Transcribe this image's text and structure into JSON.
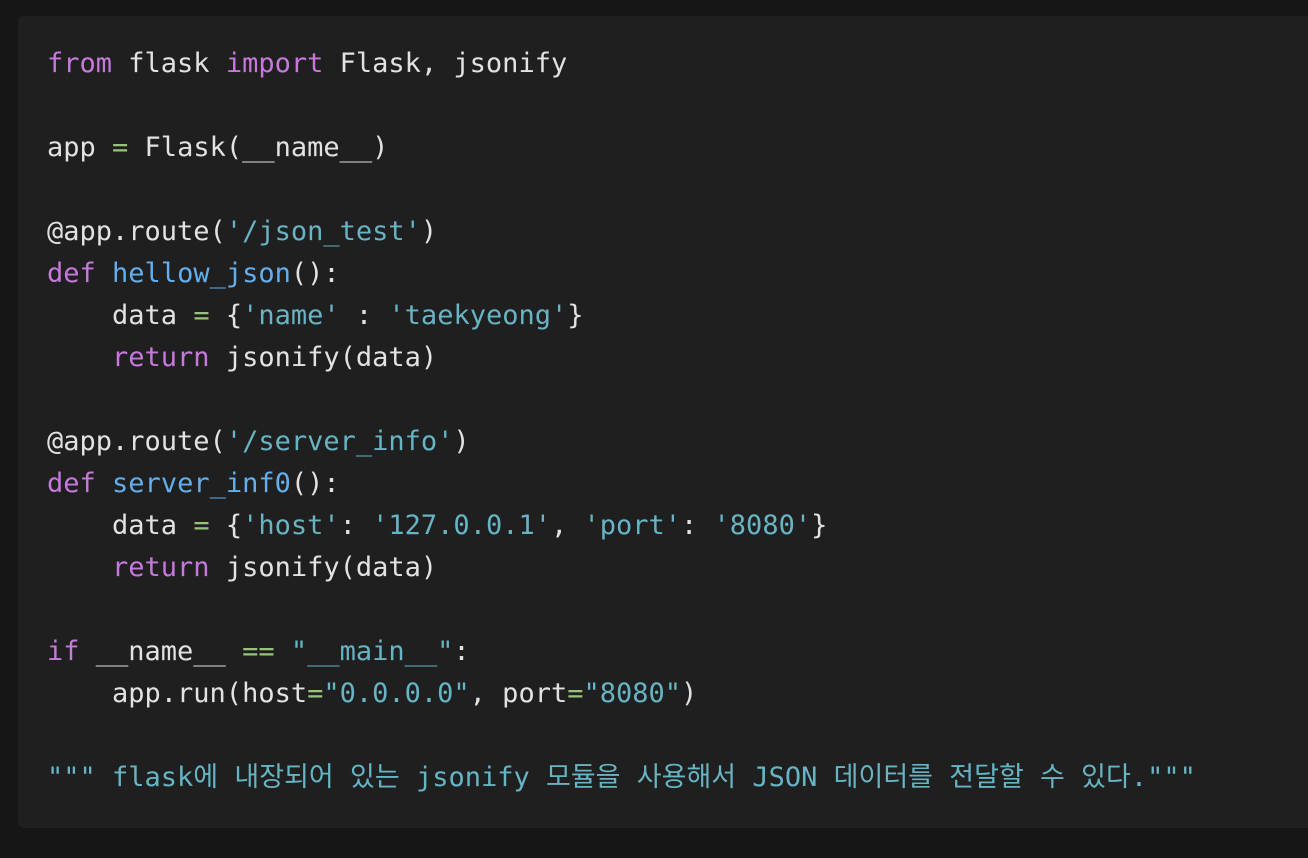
{
  "colors": {
    "background": "#161616",
    "panel": "#1f1f1f",
    "plain": "#e2e2e2",
    "keyword": "#c678dd",
    "function": "#61afef",
    "string": "#67b4c4",
    "operator": "#98c379"
  },
  "code": {
    "language": "python",
    "lines": [
      [
        {
          "t": "from",
          "k": "kw"
        },
        {
          "t": " flask ",
          "k": "pl"
        },
        {
          "t": "import",
          "k": "kw"
        },
        {
          "t": " Flask, jsonify",
          "k": "pl"
        }
      ],
      [],
      [
        {
          "t": "app ",
          "k": "pl"
        },
        {
          "t": "=",
          "k": "op"
        },
        {
          "t": " Flask(__name__)",
          "k": "pl"
        }
      ],
      [],
      [
        {
          "t": "@app.route(",
          "k": "pl"
        },
        {
          "t": "'/json_test'",
          "k": "str"
        },
        {
          "t": ")",
          "k": "pl"
        }
      ],
      [
        {
          "t": "def",
          "k": "kw"
        },
        {
          "t": " ",
          "k": "pl"
        },
        {
          "t": "hellow_json",
          "k": "fn"
        },
        {
          "t": "():",
          "k": "pl"
        }
      ],
      [
        {
          "t": "    data ",
          "k": "pl"
        },
        {
          "t": "=",
          "k": "op"
        },
        {
          "t": " {",
          "k": "pl"
        },
        {
          "t": "'name'",
          "k": "str"
        },
        {
          "t": " : ",
          "k": "pl"
        },
        {
          "t": "'taekyeong'",
          "k": "str"
        },
        {
          "t": "}",
          "k": "pl"
        }
      ],
      [
        {
          "t": "    ",
          "k": "pl"
        },
        {
          "t": "return",
          "k": "kw"
        },
        {
          "t": " jsonify(data)",
          "k": "pl"
        }
      ],
      [],
      [
        {
          "t": "@app.route(",
          "k": "pl"
        },
        {
          "t": "'/server_info'",
          "k": "str"
        },
        {
          "t": ")",
          "k": "pl"
        }
      ],
      [
        {
          "t": "def",
          "k": "kw"
        },
        {
          "t": " ",
          "k": "pl"
        },
        {
          "t": "server_inf0",
          "k": "fn"
        },
        {
          "t": "():",
          "k": "pl"
        }
      ],
      [
        {
          "t": "    data ",
          "k": "pl"
        },
        {
          "t": "=",
          "k": "op"
        },
        {
          "t": " {",
          "k": "pl"
        },
        {
          "t": "'host'",
          "k": "str"
        },
        {
          "t": ": ",
          "k": "pl"
        },
        {
          "t": "'127.0.0.1'",
          "k": "str"
        },
        {
          "t": ", ",
          "k": "pl"
        },
        {
          "t": "'port'",
          "k": "str"
        },
        {
          "t": ": ",
          "k": "pl"
        },
        {
          "t": "'8080'",
          "k": "str"
        },
        {
          "t": "}",
          "k": "pl"
        }
      ],
      [
        {
          "t": "    ",
          "k": "pl"
        },
        {
          "t": "return",
          "k": "kw"
        },
        {
          "t": " jsonify(data)",
          "k": "pl"
        }
      ],
      [],
      [
        {
          "t": "if",
          "k": "kw"
        },
        {
          "t": " __name__ ",
          "k": "pl"
        },
        {
          "t": "==",
          "k": "op"
        },
        {
          "t": " ",
          "k": "pl"
        },
        {
          "t": "\"__main__\"",
          "k": "str"
        },
        {
          "t": ":",
          "k": "pl"
        }
      ],
      [
        {
          "t": "    app.run(host",
          "k": "pl"
        },
        {
          "t": "=",
          "k": "op"
        },
        {
          "t": "\"0.0.0.0\"",
          "k": "str"
        },
        {
          "t": ", port",
          "k": "pl"
        },
        {
          "t": "=",
          "k": "op"
        },
        {
          "t": "\"8080\"",
          "k": "str"
        },
        {
          "t": ")",
          "k": "pl"
        }
      ],
      [],
      [
        {
          "t": "\"\"\" flask에 내장되어 있는 jsonify 모듈을 사용해서 JSON 데이터를 전달할 수 있다.\"\"\"",
          "k": "str"
        }
      ]
    ]
  }
}
